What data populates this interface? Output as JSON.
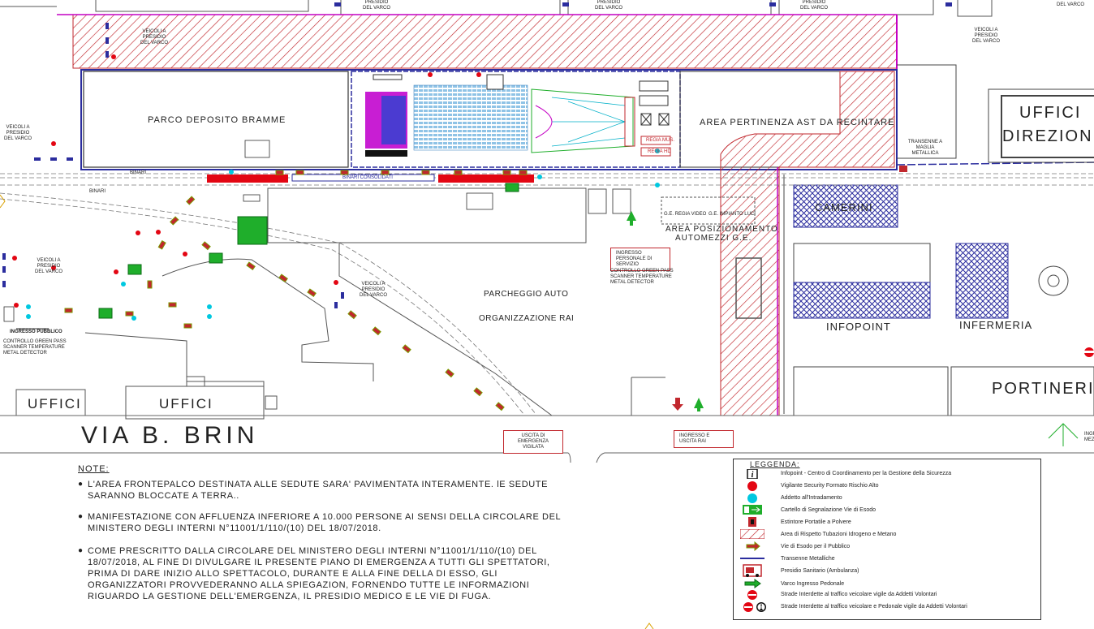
{
  "labels": {
    "parco": "PARCO DEPOSITO BRAMME",
    "area_pertinenza": "AREA PERTINENZA AST DA RECINTARE",
    "uffici_direzione_1": "UFFICI",
    "uffici_direzione_2": "DIREZIONE",
    "camerini": "CAMERINI",
    "infopoint": "INFOPOINT",
    "infermeria": "INFERMERIA",
    "portineria": "PORTINERIA",
    "uffici_a": "UFFICI",
    "uffici_b": "UFFICI",
    "via": "VIA B. BRIN",
    "parcheggio_1": "PARCHEGGIO AUTO",
    "parcheggio_2": "ORGANIZZAZIONE RAI",
    "area_pos_1": "AREA POSIZIONAMENTO",
    "area_pos_2": "AUTOMEZZI G.E.",
    "ge_regia": "G.E. REGIA VIDEO",
    "ge_impianto": "G.E. IMPIANTO LUCI",
    "binari_1": "BINARI",
    "binari_2": "BINARI",
    "binari_box": "BINARI CONSOLIDATI",
    "veicoli_1": "VEICOLI A PRESIDIO DEL VARCO",
    "veicoli_2": "VEICOLI A PRESIDIO DEL VARCO",
    "veicoli_3": "VEICOLI A PRESIDIO DEL VARCO",
    "veicoli_4": "VEICOLI A PRESIDIO DEL VARCO",
    "veicoli_5": "VEICOLI A PRESIDIO DEL VARCO",
    "varco_top_1": "PRESIDIO DEL VARCO",
    "varco_top_2": "PRESIDIO DEL VARCO",
    "varco_top_3": "PRESIDIO DEL VARCO",
    "varco_top_4": "DEL VARCO",
    "ingresso_pubblico": "INGRESSO PUBBLICO",
    "controllo_1": "CONTROLLO GREEN PASS SCANNER TEMPERATURE METAL DETECTOR",
    "ingresso_personale": "INGRESSO PERSONALE DI SERVIZIO",
    "controllo_2": "CONTROLLO GREEN PASS SCANNER TEMPERATURE METAL DETECTOR",
    "uscita_emergenza": "USCITA DI EMERGENZA VIGILATA",
    "ingresso_uscita_rai": "INGRESSO E USCITA RAI",
    "regia_mus": "REGIA MUS.",
    "regia_hd": "REGIA HD",
    "transenne": "TRANSENNE A MAGLIA METALLICA",
    "ingresso_partial": "INGR MEZ"
  },
  "notes": {
    "title": "NOTE:",
    "items": [
      "L'AREA FRONTEPALCO DESTINATA ALLE SEDUTE SARA' PAVIMENTATA INTERAMENTE. lE SEDUTE SARANNO BLOCCATE A TERRA..",
      "MANIFESTAZIONE CON AFFLUENZA INFERIORE A 10.000 PERSONE AI SENSI DELLA CIRCOLARE DEL MINISTERO DEGLI INTERNI N°11001/1/110/(10) DEL 18/07/2018.",
      "COME PRESCRITTO DALLA CIRCOLARE DEL MINISTERO DEGLI INTERNI N°11001/1/110/(10) DEL 18/07/2018, AL FINE DI DIVULGARE IL PRESENTE PIANO DI EMERGENZA A TUTTI GLI SPETTATORI, PRIMA DI DARE INIZIO ALLO SPETTACOLO, DURANTE E ALLA FINE DELLA DI ESSO, GLI ORGANIZZATORI PROVVEDERANNO ALLA SPIEGAZION, FORNENDO TUTTE LE INFORMAZIONI RIGUARDO LA GESTIONE DELL'EMERGENZA, IL PRESIDIO MEDICO E LE VIE DI FUGA."
    ]
  },
  "legend": {
    "title": "LEGGENDA:",
    "items": [
      {
        "symbol": "info-icon",
        "label": "Infopoint - Centro di Coordinamento per la Gestione della Sicurezza"
      },
      {
        "symbol": "red-dot-icon",
        "label": "Vigilante Security Formato Rischio Alto"
      },
      {
        "symbol": "cyan-dot-icon",
        "label": "Addetto all'Intradamento"
      },
      {
        "symbol": "exit-sign-icon",
        "label": "Cartello di Segnalazione Vie di Esodo"
      },
      {
        "symbol": "extinguisher-icon",
        "label": "Estintore Portatile a Polvere"
      },
      {
        "symbol": "hatch-icon",
        "label": "Area di Rispetto Tubazioni Idrogeno e Metano"
      },
      {
        "symbol": "arrow-icon",
        "label": "Vie di Esodo per il Pubblico"
      },
      {
        "symbol": "barrier-icon",
        "label": "Transenne Metalliche"
      },
      {
        "symbol": "ambulance-icon",
        "label": "Presidio Sanitario (Ambulanza)"
      },
      {
        "symbol": "entrance-arrow-icon",
        "label": "Varco Ingresso Pedonale"
      },
      {
        "symbol": "no-entry-icon",
        "label": "Strade Interdette al traffico veicolare vigile da Addetti Volontari"
      },
      {
        "symbol": "no-entry-pedestrian-icon",
        "label": "Strade Interdette al traffico veicolare e Pedonale vigile da Addetti Volontari"
      }
    ]
  },
  "colors": {
    "hatch": "#c1272d",
    "blue_hatch": "#2b2d9e",
    "boundary": "#c400c4",
    "fence": "#2b2d9e",
    "vigilante": "#e30613",
    "addetto": "#00c8e0",
    "exit": "#1fae2b",
    "arrow_fill": "#c1272d",
    "arrow_stroke": "#7a9a00"
  }
}
